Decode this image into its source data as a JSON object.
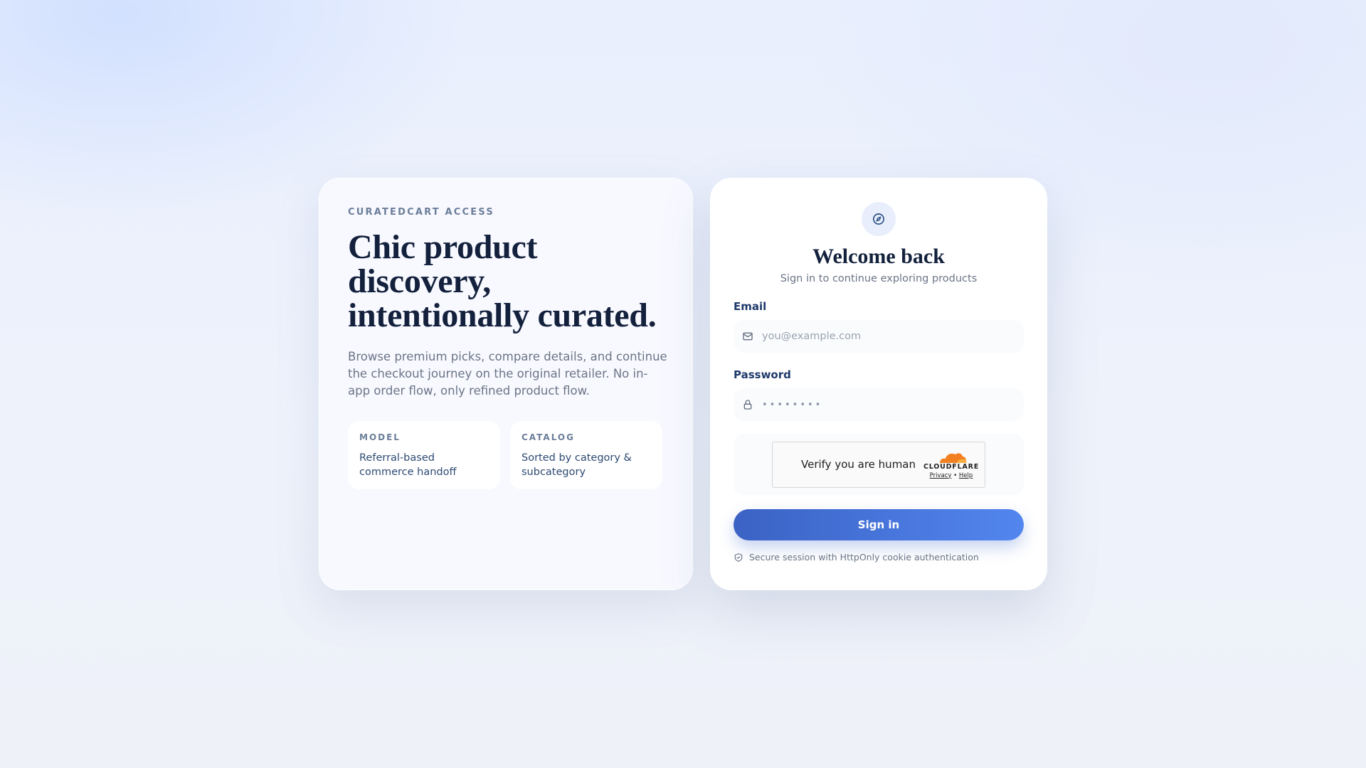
{
  "hero": {
    "eyebrow": "CURATEDCART ACCESS",
    "headline": "Chic product discovery, intentionally curated.",
    "description": "Browse premium picks, compare details, and continue the checkout journey on the original retailer. No in-app order flow, only refined product flow.",
    "features": [
      {
        "label": "MODEL",
        "text": "Referral-based commerce handoff"
      },
      {
        "label": "CATALOG",
        "text": "Sorted by category & subcategory"
      }
    ]
  },
  "login": {
    "icon": "compass-icon",
    "title": "Welcome back",
    "subtitle": "Sign in to continue exploring products",
    "email_label": "Email",
    "email_placeholder": "you@example.com",
    "password_label": "Password",
    "password_placeholder": "••••••••",
    "captcha": {
      "text": "Verify you are human",
      "brand": "CLOUDFLARE",
      "privacy": "Privacy",
      "separator": "•",
      "help": "Help"
    },
    "signin_label": "Sign in",
    "security_note": "Secure session with HttpOnly cookie authentication"
  },
  "colors": {
    "accent": "#4a7ae6",
    "heading": "#14213d",
    "label": "#1e3a6b",
    "cloudflare": "#f38020"
  }
}
